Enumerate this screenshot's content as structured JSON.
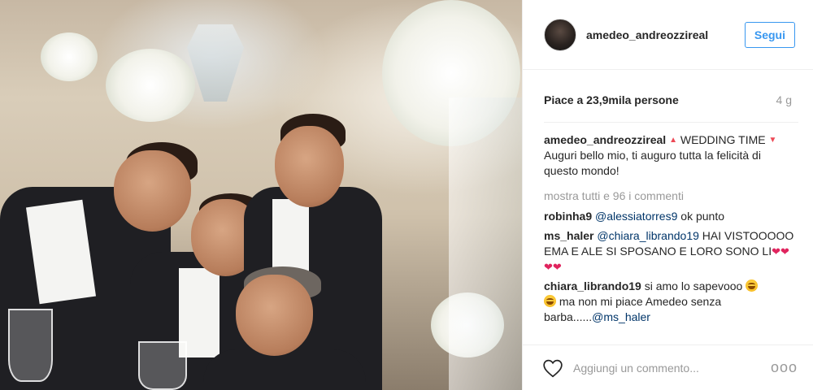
{
  "post": {
    "photo_alt": "Foto di gruppo a un matrimonio"
  },
  "header": {
    "username": "amedeo_andreozzireal",
    "follow_label": "Segui"
  },
  "stats": {
    "likes": "Piace a 23,9mila persone",
    "time": "4 g"
  },
  "caption": {
    "user": "amedeo_andreozzireal",
    "text_a": "WEDDING TIME",
    "text_b": "Auguri bello mio, ti auguro tutta la felicità di questo mondo!"
  },
  "more_comments": "mostra tutti e 96 i commenti",
  "comments": [
    {
      "user": "robinha9",
      "mention": "@alessiatorres9",
      "text": "ok punto"
    },
    {
      "user": "ms_haler",
      "mention": "@chiara_librando19",
      "text": "HAI VISTOOOOO EMA E ALE SI SPOSANO E LORO SONO LI"
    },
    {
      "user": "chiara_librando19",
      "text_a": "si amo lo sapevooo",
      "text_b": "ma non mi piace Amedeo senza barba......",
      "mention": "@ms_haler"
    }
  ],
  "footer": {
    "placeholder": "Aggiungi un commento...",
    "more_label": "ooo"
  },
  "colors": {
    "accent": "#3897f0",
    "mention": "#003569",
    "muted": "#999999",
    "heart": "#e0245e"
  },
  "icons": {
    "like": "heart-outline-icon",
    "more": "more-options-icon"
  }
}
